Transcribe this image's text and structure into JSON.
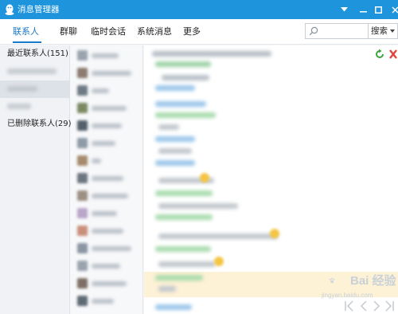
{
  "window": {
    "title": "消息管理器",
    "menu_icon": "dropdown-arrow-icon",
    "minimize_icon": "minimize-icon",
    "maximize_icon": "maximize-icon",
    "close_icon": "close-icon"
  },
  "tabs": [
    {
      "label": "联系人",
      "active": true
    },
    {
      "label": "群聊",
      "active": false
    },
    {
      "label": "临时会话",
      "active": false
    },
    {
      "label": "系统消息",
      "active": false
    },
    {
      "label": "更多",
      "active": false
    }
  ],
  "search": {
    "placeholder": "",
    "button_label": "搜索"
  },
  "groups": [
    {
      "label": "最近联系人(151)"
    },
    {
      "label": "已删除联系人(29)"
    }
  ],
  "watermark": {
    "text": "Bai 经验",
    "sub": "jingyan.baidu.com"
  },
  "colors": {
    "titlebar": "#1e94dc",
    "accent": "#1a79c8",
    "highlight_row": "#fdf1d6",
    "refresh": "#3aa53a",
    "delete": "#e0443a"
  }
}
